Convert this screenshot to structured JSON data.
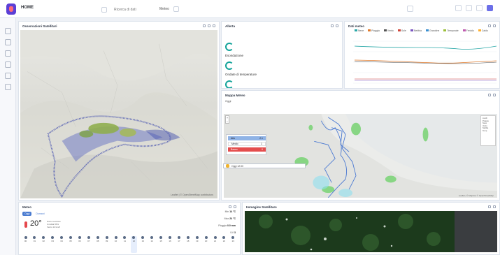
{
  "app": {
    "title": "HOME"
  },
  "toolbar": {
    "search_placeholder": "Ricerca di dati",
    "mode_label": "Meteo"
  },
  "panels": {
    "map1": {
      "title": "Osservazioni Satellitari",
      "attribution": "Leaflet | © OpenStreetMap contributors"
    },
    "alerts": {
      "title": "Allerta",
      "items": [
        "Esondazione",
        "Ondate di temperature"
      ]
    },
    "chart": {
      "title": "Dati meteo",
      "legend": [
        "Neve",
        "Pioggia",
        "Vento",
        "Sole",
        "Nebbia",
        "Grandine",
        "Temporale",
        "Freddo",
        "Caldo"
      ]
    },
    "weathermap": {
      "title": "Mappa Meteo",
      "subtitle": "Oggi",
      "legend": [
        {
          "label": "Alto",
          "value": "2.1",
          "color": "#8fb3e6"
        },
        {
          "label": "Medio",
          "value": "1",
          "color": "#ffffff"
        },
        {
          "label": "Basso",
          "value": "0",
          "color": "#e44d4d"
        }
      ],
      "time_label": "Oggi 12:00",
      "right_legend": [
        "Livelli",
        "Pioggia",
        "Neve",
        "Vento",
        "Nebbia",
        "Temp"
      ],
      "attribution": "Leaflet | © Mapbox © OpenStreetMap"
    },
    "forecast": {
      "title": "Meteo",
      "tabs": [
        "Oggi",
        "Domani"
      ],
      "temperature": "20°",
      "condition": [
        "Poco nuvoloso",
        "Umidità 55%",
        "Vento 12 km/h"
      ],
      "stats": [
        {
          "label": "Min",
          "value": "14 °C"
        },
        {
          "label": "Max",
          "value": "24 °C"
        },
        {
          "label": "Pioggia",
          "value": "0.0 mm"
        },
        {
          "label": "UV",
          "value": "3"
        }
      ],
      "hours": [
        "00",
        "01",
        "02",
        "03",
        "04",
        "05",
        "06",
        "07",
        "08",
        "09",
        "10",
        "11",
        "12",
        "13",
        "14",
        "15",
        "16",
        "17",
        "18",
        "19",
        "20",
        "21",
        "22",
        "23"
      ]
    },
    "satellite": {
      "title": "Immagine Satellitare"
    }
  }
}
